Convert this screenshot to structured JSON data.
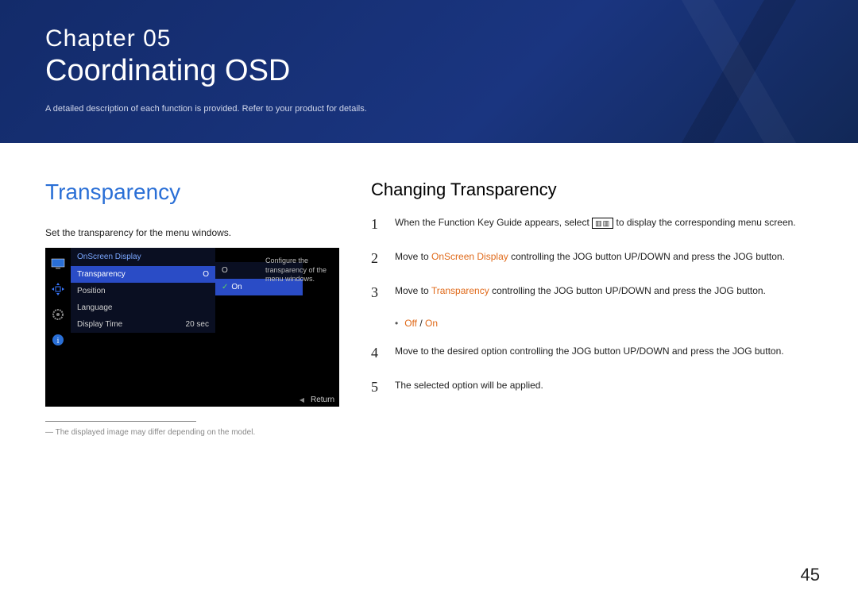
{
  "header": {
    "chapter_label": "Chapter  05",
    "chapter_title": "Coordinating OSD",
    "description": "A detailed description of each function is provided. Refer to your product for details."
  },
  "left": {
    "title": "Transparency",
    "desc": "Set the transparency for the menu windows.",
    "footnote": "― The displayed image may differ depending on the model."
  },
  "osd": {
    "menu_title": "OnScreen Display",
    "items": [
      {
        "label": "Transparency",
        "value": "O"
      },
      {
        "label": "Position",
        "value": ""
      },
      {
        "label": "Language",
        "value": ""
      },
      {
        "label": "Display Time",
        "value": "20 sec"
      }
    ],
    "sub": {
      "off": "O",
      "on": "On"
    },
    "tooltip": "Conﬁgure the transparency of the menu windows.",
    "return": "Return"
  },
  "right": {
    "title": "Changing Transparency",
    "steps": {
      "s1a": "When the Function Key Guide appears, select ",
      "s1b": " to display the corresponding menu screen.",
      "s2a": "Move to ",
      "s2link": "OnScreen Display",
      "s2b": " controlling the JOG button UP/DOWN and press the JOG button.",
      "s3a": "Move to ",
      "s3link": "Transparency",
      "s3b": " controlling the JOG button UP/DOWN and press the JOG button.",
      "opt_off": "Off",
      "opt_sep": " / ",
      "opt_on": "On",
      "s4": "Move to the desired option controlling the JOG button UP/DOWN and press the JOG button.",
      "s5": "The selected option will be applied."
    }
  },
  "page_number": "45"
}
